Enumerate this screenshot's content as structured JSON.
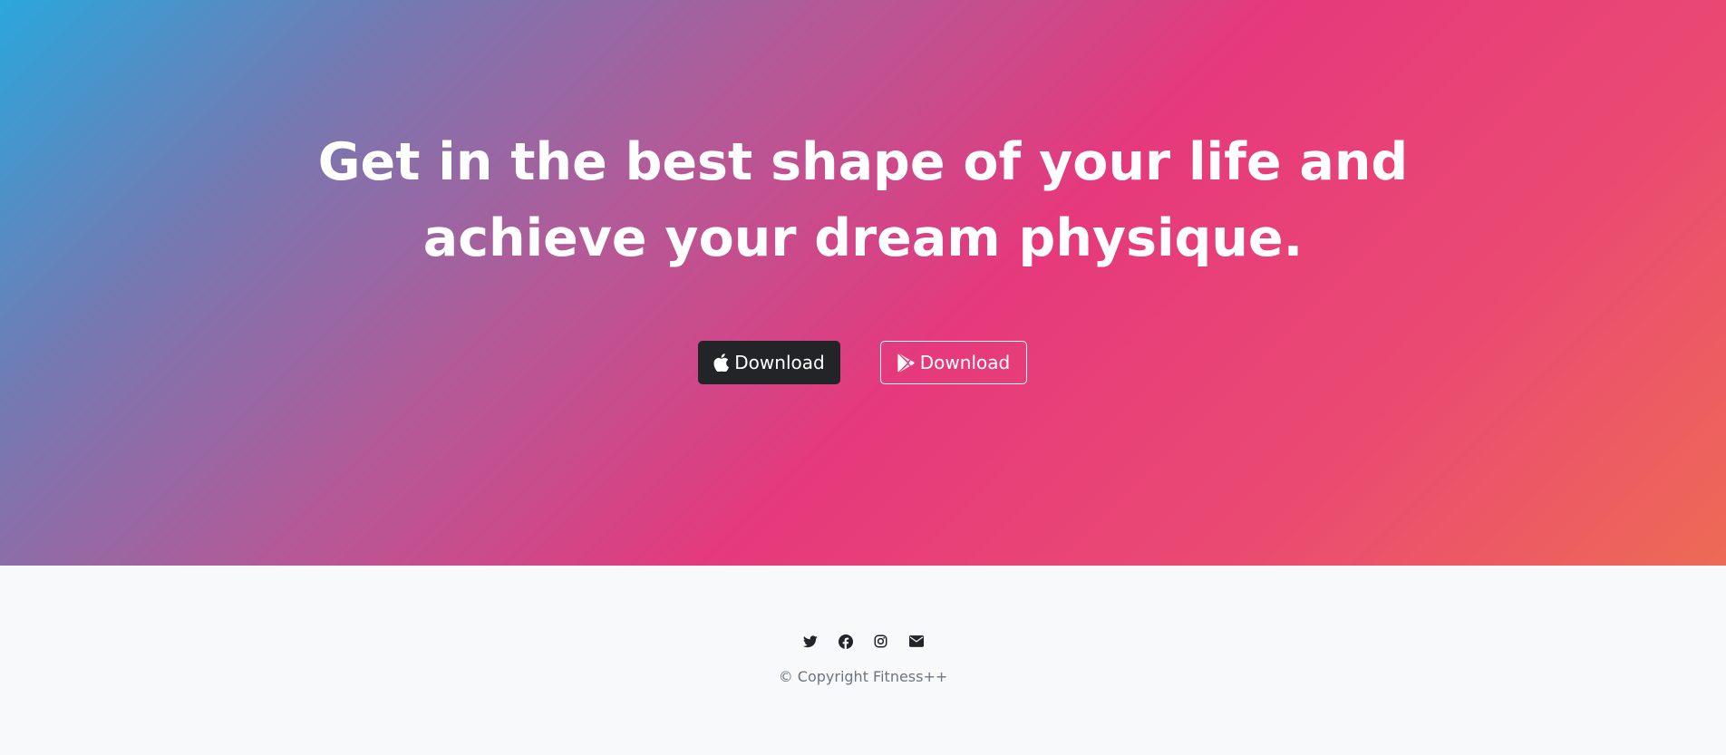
{
  "hero": {
    "headline_line1": "Get in the best shape of your life and",
    "headline_line2": "achieve your dream physique.",
    "gradient_colors": [
      "#2aa7dc",
      "#e6397c",
      "#ee6a55"
    ],
    "buttons": [
      {
        "label": "Download",
        "icon": "apple-icon",
        "style": "dark",
        "color": "#222427"
      },
      {
        "label": "Download",
        "icon": "google-play-icon",
        "style": "outline",
        "color": "#ffffff"
      }
    ]
  },
  "footer": {
    "social_icons": [
      "twitter-icon",
      "facebook-icon",
      "instagram-icon",
      "envelope-icon"
    ],
    "copyright": "© Copyright Fitness++",
    "background": "#f8f9fa"
  }
}
